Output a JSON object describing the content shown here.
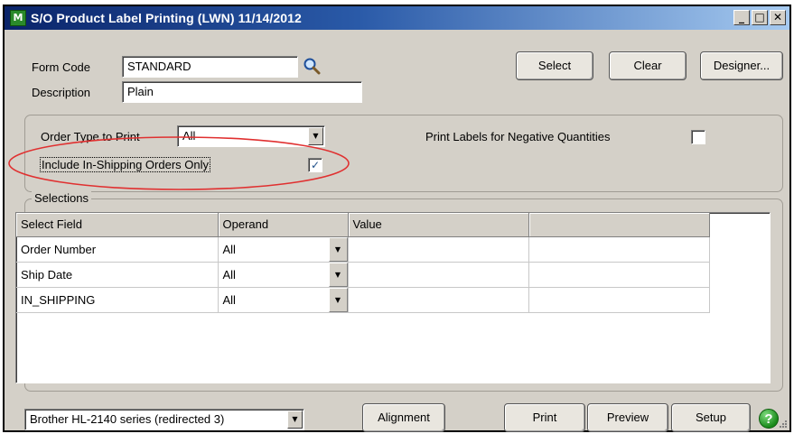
{
  "window": {
    "app_icon_text": "M",
    "title": "S/O Product Label Printing (LWN) 11/14/2012",
    "controls": {
      "minimize": "_",
      "maximize": "□",
      "close": "✕"
    }
  },
  "form": {
    "form_code_label": "Form Code",
    "form_code_value": "STANDARD",
    "description_label": "Description",
    "description_value": "Plain"
  },
  "buttons": {
    "select": "Select",
    "clear": "Clear",
    "designer": "Designer...",
    "alignment": "Alignment",
    "print": "Print",
    "preview": "Preview",
    "setup": "Setup",
    "help": "?"
  },
  "options": {
    "order_type_label": "Order Type to Print",
    "order_type_value": "All",
    "include_in_shipping_label": "Include In-Shipping Orders Only",
    "include_in_shipping_checked": true,
    "negative_qty_label": "Print Labels for Negative Quantities",
    "negative_qty_checked": false,
    "check_mark": "✓"
  },
  "selections": {
    "legend": "Selections",
    "columns": [
      "Select Field",
      "Operand",
      "Value",
      ""
    ],
    "rows": [
      {
        "field": "Order Number",
        "operand": "All",
        "value": ""
      },
      {
        "field": "Ship Date",
        "operand": "All",
        "value": ""
      },
      {
        "field": "IN_SHIPPING",
        "operand": "All",
        "value": ""
      }
    ]
  },
  "printer": {
    "value": "Brother HL-2140 series (redirected 3)"
  },
  "icons": {
    "lookup": "search-icon",
    "help": "help-icon",
    "dropdown": "chevron-down-icon"
  },
  "colors": {
    "title_start": "#0a246a",
    "title_end": "#a6caf0",
    "window_bg": "#d4d0c8",
    "highlight_ellipse": "#e03030"
  }
}
